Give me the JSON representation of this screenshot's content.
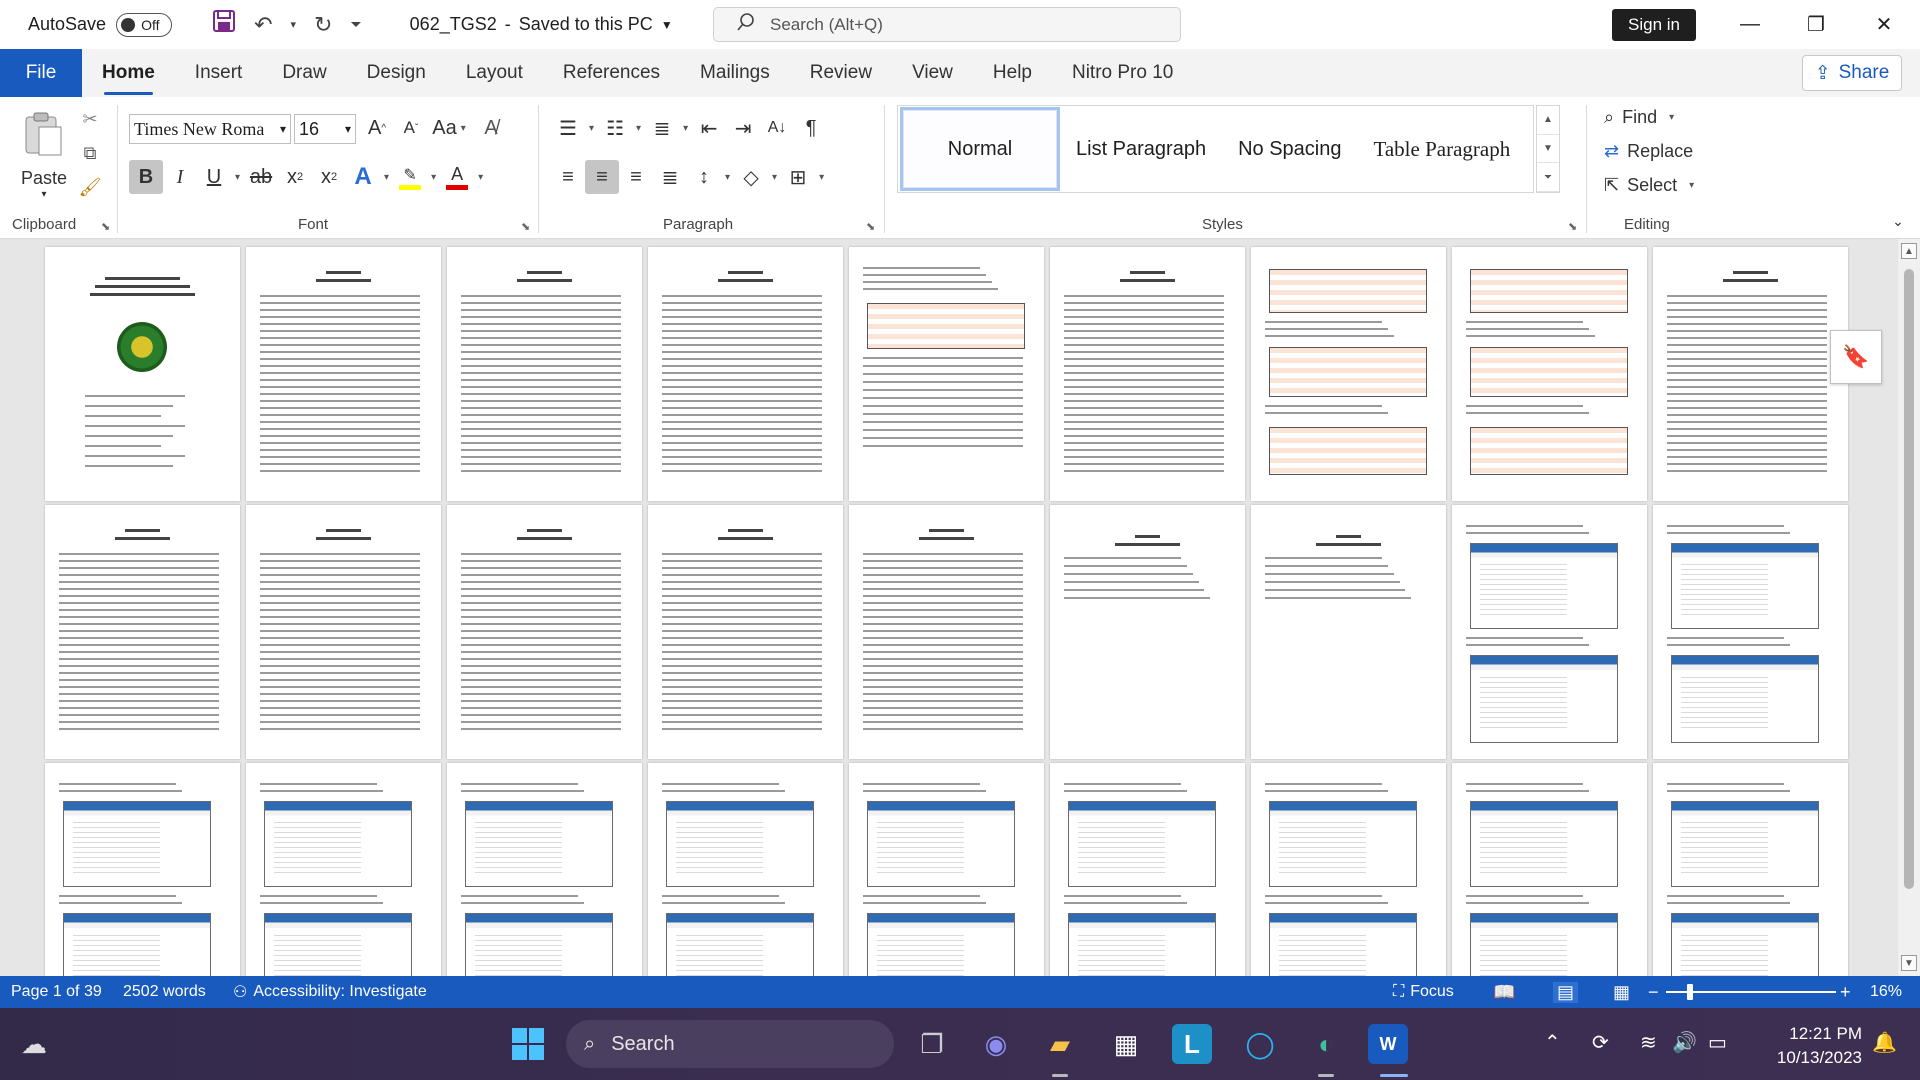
{
  "titlebar": {
    "autosave_label": "AutoSave",
    "autosave_state": "Off",
    "doc_title": "062_TGS2",
    "save_status": "Saved to this PC",
    "search_placeholder": "Search (Alt+Q)",
    "signin_label": "Sign in"
  },
  "tabs": [
    "File",
    "Home",
    "Insert",
    "Draw",
    "Design",
    "Layout",
    "References",
    "Mailings",
    "Review",
    "View",
    "Help",
    "Nitro Pro 10"
  ],
  "share_label": "Share",
  "ribbon": {
    "clipboard": {
      "label": "Clipboard",
      "paste": "Paste"
    },
    "font": {
      "label": "Font",
      "name": "Times New Roma",
      "size": "16"
    },
    "paragraph": {
      "label": "Paragraph"
    },
    "styles": {
      "label": "Styles",
      "items": [
        "Normal",
        "List Paragraph",
        "No Spacing",
        "Table Paragraph"
      ]
    },
    "editing": {
      "label": "Editing",
      "find": "Find",
      "replace": "Replace",
      "select": "Select"
    }
  },
  "statusbar": {
    "page": "Page 1 of 39",
    "words": "2502 words",
    "accessibility": "Accessibility: Investigate",
    "focus": "Focus",
    "zoom": "16%"
  },
  "taskbar": {
    "search": "Search",
    "time": "12:21 PM",
    "date": "10/13/2023"
  },
  "colors": {
    "accent": "#185abd",
    "taskbar": "#3a2d50"
  }
}
